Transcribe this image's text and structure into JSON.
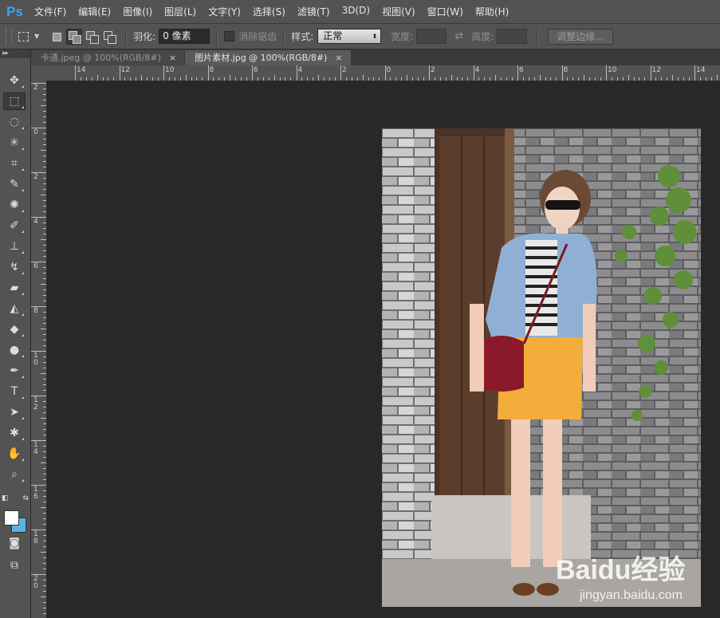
{
  "app": {
    "logo": "Ps"
  },
  "menu": [
    "文件(F)",
    "编辑(E)",
    "图像(I)",
    "图层(L)",
    "文字(Y)",
    "选择(S)",
    "滤镜(T)",
    "3D(D)",
    "视图(V)",
    "窗口(W)",
    "帮助(H)"
  ],
  "options": {
    "feather_label": "羽化:",
    "feather_value": "0 像素",
    "antialias_label": "消除锯齿",
    "style_label": "样式:",
    "style_value": "正常",
    "width_label": "宽度:",
    "height_label": "高度:",
    "refine_edge_label": "调整边缘..."
  },
  "tabs": [
    {
      "label": "卡通.jpeg @ 100%(RGB/8#)",
      "active": false
    },
    {
      "label": "图片素材.jpg @ 100%(RGB/8#)",
      "active": true
    }
  ],
  "ruler": {
    "h_labels": [
      "14",
      "12",
      "10",
      "8",
      "6",
      "4",
      "2",
      "0",
      "2",
      "4",
      "6",
      "8",
      "10",
      "12",
      "14"
    ],
    "v_labels": [
      "2",
      "0",
      "2",
      "4",
      "6",
      "8",
      "1\n0",
      "1\n2",
      "1\n4",
      "1\n6",
      "1\n8",
      "2\n0"
    ]
  },
  "tools": [
    "move-tool-icon",
    "marquee-tool-icon",
    "lasso-tool-icon",
    "magic-wand-icon",
    "crop-tool-icon",
    "eyedropper-icon",
    "healing-brush-icon",
    "brush-tool-icon",
    "clone-stamp-icon",
    "history-brush-icon",
    "eraser-tool-icon",
    "paint-bucket-icon",
    "blur-tool-icon",
    "dodge-tool-icon",
    "pen-tool-icon",
    "type-tool-icon",
    "path-selection-icon",
    "custom-shape-icon",
    "hand-tool-icon",
    "zoom-tool-icon"
  ],
  "swatches": {
    "foreground": "#ffffff",
    "background": "#5ab3e4"
  },
  "watermark": {
    "brand": "Baidu经验",
    "url": "jingyan.baidu.com"
  },
  "colors": {
    "accent": "#31a8ff",
    "chrome": "#535353",
    "canvas": "#282828"
  }
}
